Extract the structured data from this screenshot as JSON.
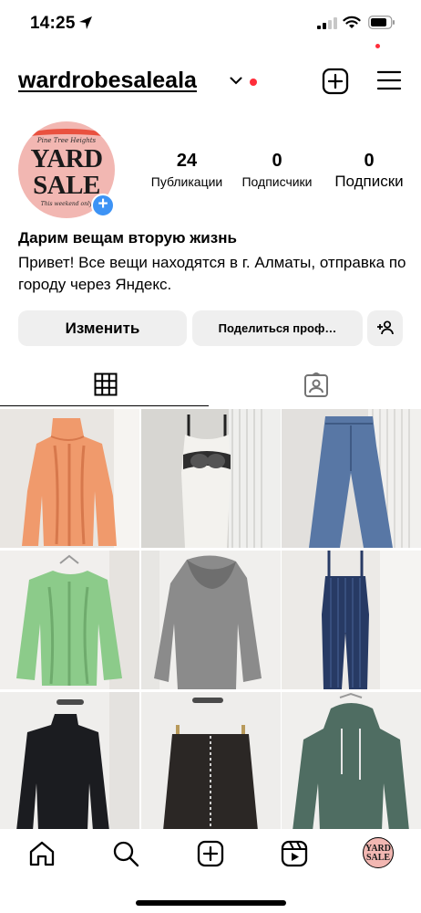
{
  "status_bar": {
    "time": "14:25",
    "icons": [
      "location-arrow-icon",
      "cellular-signal-icon",
      "wifi-icon",
      "battery-icon"
    ]
  },
  "header": {
    "username": "wardrobesaleala",
    "icons": [
      "chevron-down-icon",
      "new-post-icon",
      "menu-icon"
    ],
    "notification_dot_color": "#ff2d3a"
  },
  "profile": {
    "avatar": {
      "top_text": "Pine Tree Heights",
      "main_text": "YARD SALE",
      "bottom_text": "This weekend only"
    },
    "stats": [
      {
        "value": "24",
        "label": "Публикации"
      },
      {
        "value": "0",
        "label": "Подписчики"
      },
      {
        "value": "0",
        "label": "Подписки"
      }
    ],
    "bio_name": "Дарим вещам вторую жизнь",
    "bio_text": "Привет! Все вещи находятся в г. Алматы, отправка по городу через Яндекс."
  },
  "actions": {
    "edit_label": "Изменить",
    "share_label": "Поделиться проф…",
    "add_user_icon": "add-person-icon"
  },
  "tabs": [
    {
      "icon": "grid-icon",
      "active": true
    },
    {
      "icon": "tagged-person-icon",
      "active": false
    }
  ],
  "posts": [
    {
      "item": "orange cable-knit turtleneck sweater",
      "color": "#f09a6c"
    },
    {
      "item": "white dress with black lace waist",
      "color": "#ecebe6"
    },
    {
      "item": "wide-leg blue jeans",
      "color": "#5877a5"
    },
    {
      "item": "green cable-knit sweater",
      "color": "#8ccb8a"
    },
    {
      "item": "grey cowl-neck sweater",
      "color": "#8b8b8b"
    },
    {
      "item": "navy striped jumpsuit",
      "color": "#273a64"
    },
    {
      "item": "black turtleneck top",
      "color": "#1b1c20"
    },
    {
      "item": "black mini skirt",
      "color": "#2b2725"
    },
    {
      "item": "green hoodie",
      "color": "#4f6d62"
    }
  ],
  "bottom_nav": {
    "items": [
      "home-icon",
      "search-icon",
      "create-icon",
      "reels-icon",
      "profile-avatar"
    ],
    "profile_avatar_text": "YARD SALE"
  },
  "colors": {
    "accent_blue": "#3d93f5",
    "button_bg": "#efefef",
    "avatar_bg": "#f2b7b2"
  }
}
